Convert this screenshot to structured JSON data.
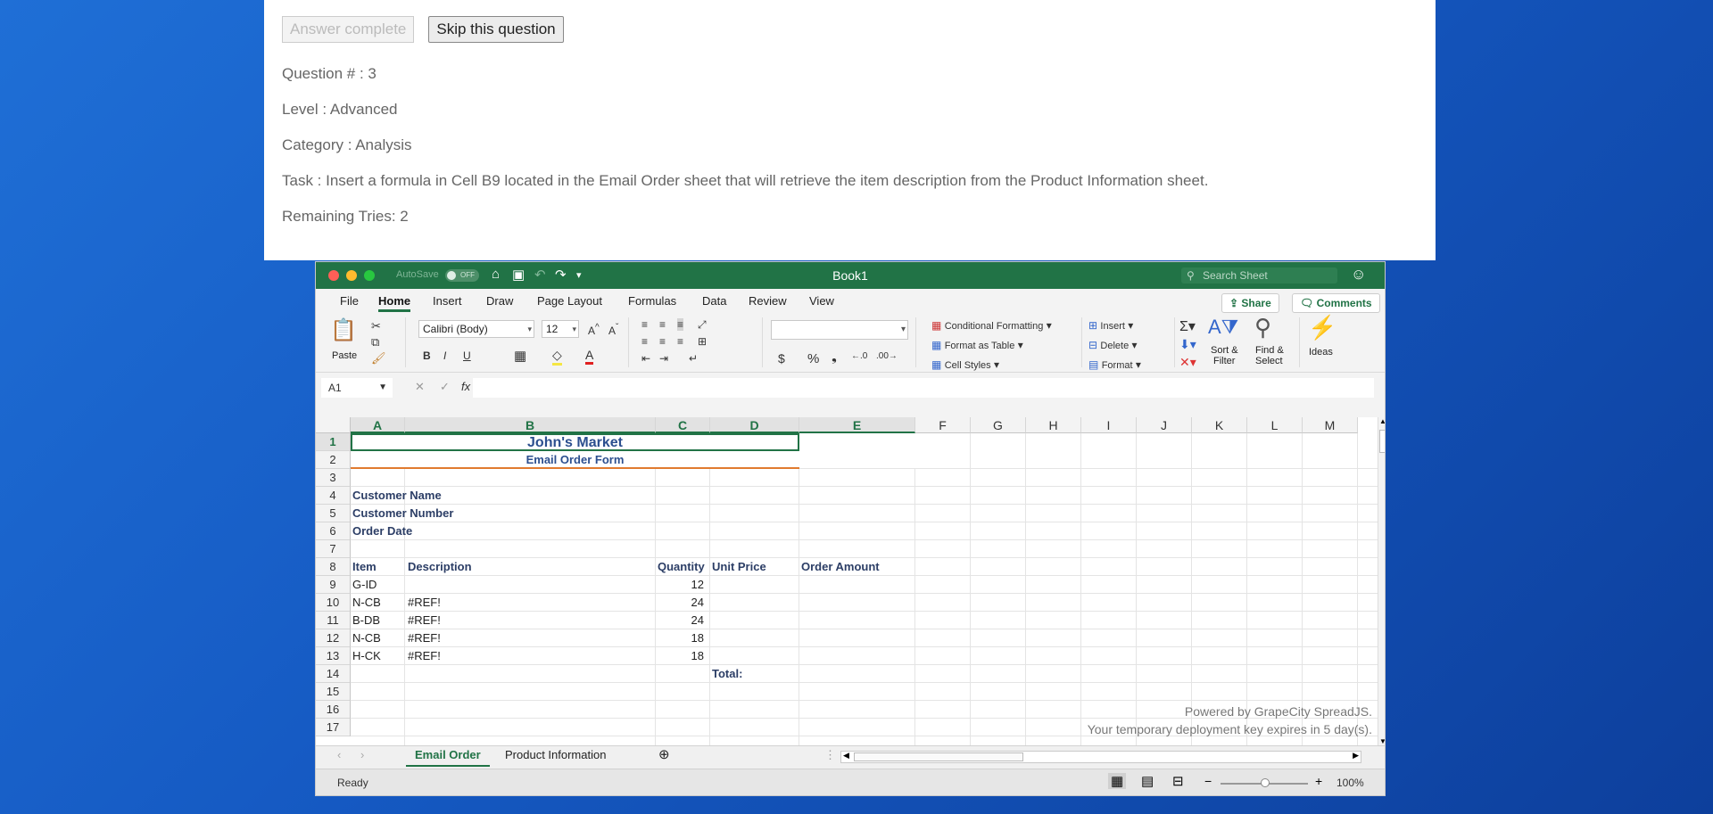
{
  "question": {
    "answer_complete_label": "Answer complete",
    "skip_label": "Skip this question",
    "number": "Question # : 3",
    "level": "Level : Advanced",
    "category": "Category : Analysis",
    "task": "Task : Insert a formula in Cell B9 located in the Email Order sheet that will retrieve the item description from the Product Information sheet.",
    "remaining": "Remaining Tries: 2"
  },
  "titlebar": {
    "title": "Book1",
    "autosave": "AutoSave",
    "autosave_state": "OFF",
    "search_placeholder": "Search Sheet"
  },
  "menu": [
    "File",
    "Home",
    "Insert",
    "Draw",
    "Page Layout",
    "Formulas",
    "Data",
    "Review",
    "View"
  ],
  "menu_active": "Home",
  "share_label": "Share",
  "comments_label": "Comments",
  "ribbon": {
    "paste": "Paste",
    "font": "Calibri (Body)",
    "size": "12",
    "conditional_formatting": "Conditional Formatting",
    "format_as_table": "Format as Table",
    "cell_styles": "Cell Styles",
    "insert": "Insert",
    "delete": "Delete",
    "format": "Format",
    "sort_filter_1": "Sort &",
    "sort_filter_2": "Filter",
    "find_select_1": "Find &",
    "find_select_2": "Select",
    "ideas": "Ideas"
  },
  "formula_bar": {
    "name_box": "A1",
    "fx": "fx"
  },
  "columns": [
    "A",
    "B",
    "C",
    "D",
    "E",
    "F",
    "G",
    "H",
    "I",
    "J",
    "K",
    "L",
    "M"
  ],
  "rows": [
    "1",
    "2",
    "3",
    "4",
    "5",
    "6",
    "7",
    "8",
    "9",
    "10",
    "11",
    "12",
    "13",
    "14",
    "15",
    "16",
    "17"
  ],
  "sheet": {
    "title": "John's Market",
    "subtitle": "Email Order Form",
    "customer_name": "Customer Name",
    "customer_number": "Customer Number",
    "order_date": "Order Date",
    "headers": {
      "item": "Item",
      "description": "Description",
      "quantity": "Quantity",
      "unit_price": "Unit Price",
      "order_amount": "Order Amount"
    },
    "items": [
      {
        "item": "G-ID",
        "description": "",
        "quantity": "12"
      },
      {
        "item": "N-CB",
        "description": "#REF!",
        "quantity": "24"
      },
      {
        "item": "B-DB",
        "description": "#REF!",
        "quantity": "24"
      },
      {
        "item": "N-CB",
        "description": "#REF!",
        "quantity": "18"
      },
      {
        "item": "H-CK",
        "description": "#REF!",
        "quantity": "18"
      }
    ],
    "total_label": "Total:",
    "watermark_1": "Powered by GrapeCity SpreadJS.",
    "watermark_2": "Your temporary deployment key expires in 5 day(s)."
  },
  "tabs": [
    "Email Order",
    "Product Information"
  ],
  "status": {
    "ready": "Ready",
    "zoom": "100%"
  },
  "colors": {
    "excel_green": "#217346",
    "header_blue": "#2c4f8f",
    "accent_orange": "#e07a2f"
  }
}
